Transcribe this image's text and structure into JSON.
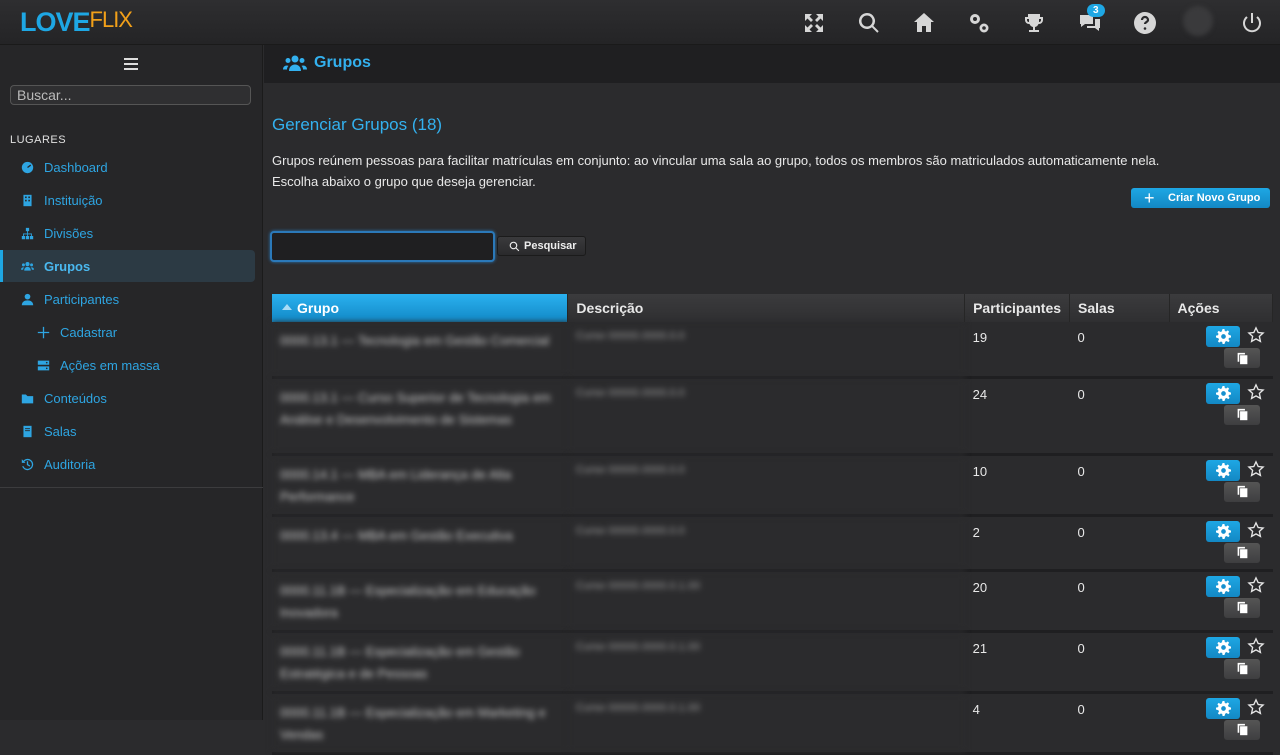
{
  "brand": {
    "love": "LOVE",
    "flix": "FLIX"
  },
  "topbar": {
    "icons": [
      "fullscreen-icon",
      "search-icon",
      "home-icon",
      "settings-icon",
      "trophy-icon",
      "chat-icon",
      "help-icon",
      "avatar",
      "power-icon"
    ],
    "notifications": "3"
  },
  "sidebar": {
    "search_placeholder": "Buscar...",
    "section": "LUGARES",
    "items": [
      {
        "label": "Dashboard",
        "icon": "dashboard-icon"
      },
      {
        "label": "Instituição",
        "icon": "building-icon"
      },
      {
        "label": "Divisões",
        "icon": "sitemap-icon"
      },
      {
        "label": "Grupos",
        "icon": "users-icon",
        "active": true
      },
      {
        "label": "Participantes",
        "icon": "user-icon"
      },
      {
        "label": "Cadastrar",
        "icon": "plus-icon"
      },
      {
        "label": "Ações em massa",
        "icon": "server-icon"
      },
      {
        "label": "Conteúdos",
        "icon": "folder-icon"
      },
      {
        "label": "Salas",
        "icon": "book-icon"
      },
      {
        "label": "Auditoria",
        "icon": "history-icon"
      }
    ]
  },
  "page": {
    "breadcrumb_title": "Grupos",
    "heading": "Gerenciar Grupos (18)",
    "description_line1": "Grupos reúnem pessoas para facilitar matrículas em conjunto: ao vincular uma sala ao grupo, todos os membros são matriculados automaticamente nela.",
    "description_line2": "Escolha abaixo o grupo que deseja gerenciar.",
    "new_button": "Criar Novo Grupo",
    "search_button": "Pesquisar",
    "search_value": ""
  },
  "table": {
    "columns": [
      "Grupo",
      "Descrição",
      "Participantes",
      "Salas",
      "Ações"
    ],
    "rows": [
      {
        "grupo": "0000.13.1 — Tecnologia em Gestão Comercial",
        "descricao": "Curso 00000.0000.0.0",
        "participantes": "19",
        "salas": "0"
      },
      {
        "grupo": "0000.13.1 — Curso Superior de Tecnologia em Análise e Desenvolvimento de Sistemas",
        "descricao": "Curso 00000.0000.0.0",
        "participantes": "24",
        "salas": "0"
      },
      {
        "grupo": "0000.14.1 — MBA em Liderança de Alta Performance",
        "descricao": "Curso 00000.0000.0.0",
        "participantes": "10",
        "salas": "0"
      },
      {
        "grupo": "0000.13.4 — MBA em Gestão Executiva",
        "descricao": "Curso 00000.0000.0.0",
        "participantes": "2",
        "salas": "0"
      },
      {
        "grupo": "0000.11.1B — Especialização em Educação Inovadora",
        "descricao": "Curso 00000.0000.0.1.00",
        "participantes": "20",
        "salas": "0"
      },
      {
        "grupo": "0000.11.1B — Especialização em Gestão Estratégica e de Pessoas",
        "descricao": "Curso 00000.0000.0.1.00",
        "participantes": "21",
        "salas": "0"
      },
      {
        "grupo": "0000.11.1B — Especialização em Marketing e Vendas",
        "descricao": "Curso 00000.0000.0.1.00",
        "participantes": "4",
        "salas": "0"
      }
    ]
  },
  "colors": {
    "accent": "#1ea7e4",
    "brand_orange": "#f2a019"
  }
}
